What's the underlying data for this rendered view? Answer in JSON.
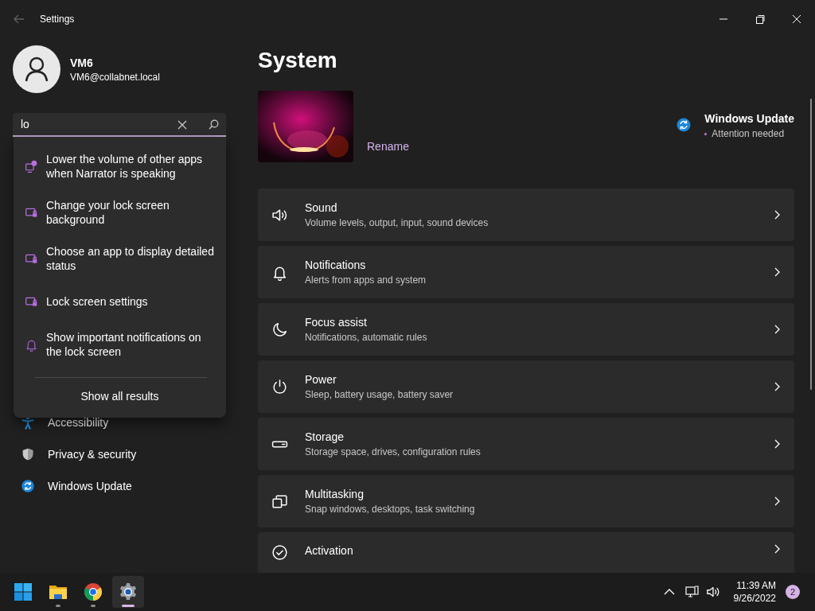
{
  "window": {
    "title": "Settings",
    "back_disabled": true
  },
  "user": {
    "name": "VM6",
    "email": "VM6@collabnet.local"
  },
  "search": {
    "value": "lo",
    "results": [
      {
        "text": "Lower the volume of other apps when Narrator is speaking",
        "kind": "narrator"
      },
      {
        "text": "Change your lock screen background",
        "kind": "lock-screen"
      },
      {
        "text": "Choose an app to display detailed status",
        "kind": "lock-screen"
      },
      {
        "text": "Lock screen settings",
        "kind": "lock-screen"
      },
      {
        "text": "Show important notifications on the lock screen",
        "kind": "bell"
      }
    ],
    "show_all": "Show all results"
  },
  "sidebar": {
    "items": [
      {
        "label": "Accessibility",
        "kind": "accessibility",
        "selected": false
      },
      {
        "label": "Privacy & security",
        "kind": "shield",
        "selected": false
      },
      {
        "label": "Windows Update",
        "kind": "update",
        "selected": false
      }
    ]
  },
  "page": {
    "title": "System",
    "device": {
      "kind": "picture",
      "rename": "Rename"
    },
    "update": {
      "title": "Windows Update",
      "status": "Attention needed"
    }
  },
  "cards": [
    {
      "title": "Sound",
      "subtitle": "Volume levels, output, input, sound devices",
      "kind": "sound"
    },
    {
      "title": "Notifications",
      "subtitle": "Alerts from apps and system",
      "kind": "bell"
    },
    {
      "title": "Focus assist",
      "subtitle": "Notifications, automatic rules",
      "kind": "moon"
    },
    {
      "title": "Power",
      "subtitle": "Sleep, battery usage, battery saver",
      "kind": "power"
    },
    {
      "title": "Storage",
      "subtitle": "Storage space, drives, configuration rules",
      "kind": "storage"
    },
    {
      "title": "Multitasking",
      "subtitle": "Snap windows, desktops, task switching",
      "kind": "multitask"
    },
    {
      "title": "Activation",
      "kind": "check"
    }
  ],
  "taskbar": {
    "apps": [
      {
        "kind": "start",
        "running": false,
        "selected": false
      },
      {
        "kind": "folder",
        "running": true,
        "selected": false
      },
      {
        "kind": "browser",
        "running": true,
        "selected": false
      },
      {
        "kind": "gear",
        "running": true,
        "selected": true
      }
    ],
    "time": "11:39 AM",
    "date": "9/26/2022",
    "badge": "2"
  }
}
